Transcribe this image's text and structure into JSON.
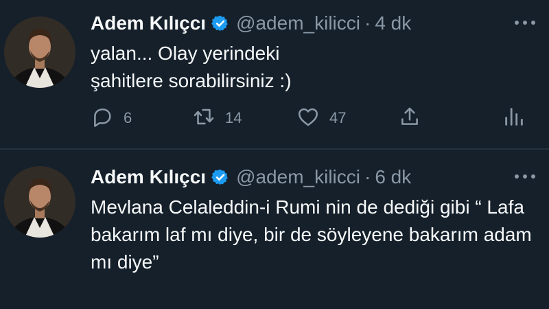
{
  "tweets": [
    {
      "author_name": "Adem Kılıçcı",
      "handle": "@adem_kilicci",
      "separator": "·",
      "time": "4 dk",
      "text": "yalan... Olay yerindeki şahitlere sorabilirsiniz :)",
      "replies": "6",
      "retweets": "14",
      "likes": "47"
    },
    {
      "author_name": "Adem Kılıçcı",
      "handle": "@adem_kilicci",
      "separator": "·",
      "time": "6 dk",
      "text": "Mevlana Celaleddin-i Rumi nin de dediği gibi “ Lafa bakarım laf mı diye, bir de söyleyene bakarım adam mı diye”"
    }
  ],
  "icons": {
    "verified": "verified-badge-icon",
    "more": "more-options-icon",
    "reply": "reply-icon",
    "retweet": "retweet-icon",
    "like": "heart-icon",
    "share": "share-icon",
    "stats": "analytics-icon"
  },
  "colors": {
    "background": "#15202b",
    "text_primary": "#f7f9f9",
    "text_secondary": "#8b98a5",
    "verified": "#1d9bf0"
  }
}
